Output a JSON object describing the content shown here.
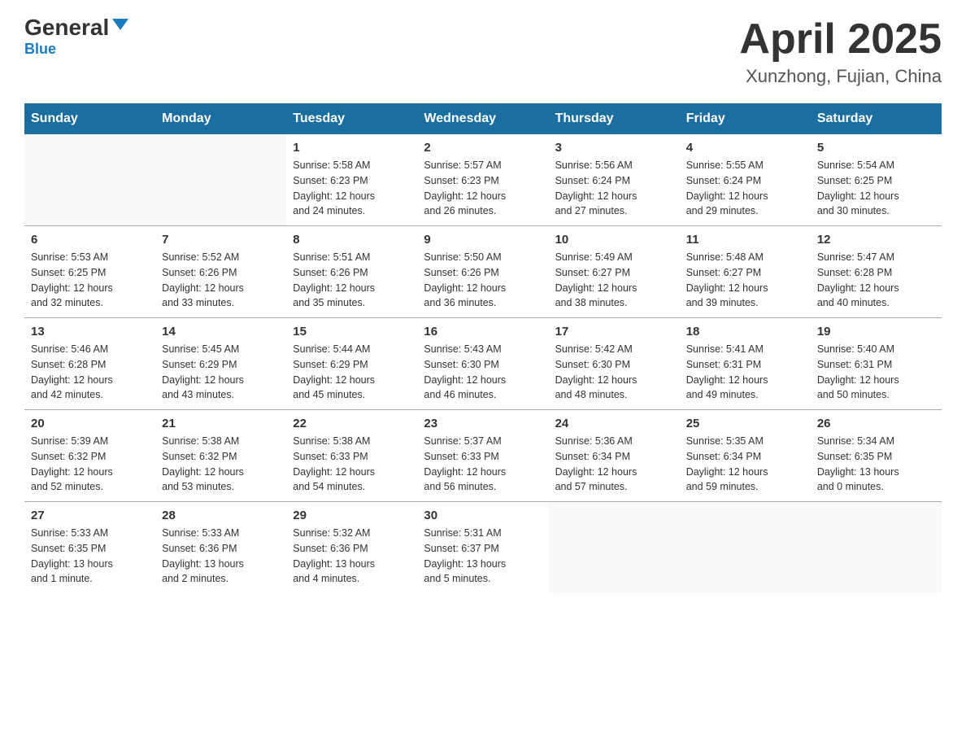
{
  "header": {
    "logo_main": "General",
    "logo_sub": "Blue",
    "title": "April 2025",
    "subtitle": "Xunzhong, Fujian, China"
  },
  "days_of_week": [
    "Sunday",
    "Monday",
    "Tuesday",
    "Wednesday",
    "Thursday",
    "Friday",
    "Saturday"
  ],
  "weeks": [
    [
      {
        "day": "",
        "info": ""
      },
      {
        "day": "",
        "info": ""
      },
      {
        "day": "1",
        "info": "Sunrise: 5:58 AM\nSunset: 6:23 PM\nDaylight: 12 hours\nand 24 minutes."
      },
      {
        "day": "2",
        "info": "Sunrise: 5:57 AM\nSunset: 6:23 PM\nDaylight: 12 hours\nand 26 minutes."
      },
      {
        "day": "3",
        "info": "Sunrise: 5:56 AM\nSunset: 6:24 PM\nDaylight: 12 hours\nand 27 minutes."
      },
      {
        "day": "4",
        "info": "Sunrise: 5:55 AM\nSunset: 6:24 PM\nDaylight: 12 hours\nand 29 minutes."
      },
      {
        "day": "5",
        "info": "Sunrise: 5:54 AM\nSunset: 6:25 PM\nDaylight: 12 hours\nand 30 minutes."
      }
    ],
    [
      {
        "day": "6",
        "info": "Sunrise: 5:53 AM\nSunset: 6:25 PM\nDaylight: 12 hours\nand 32 minutes."
      },
      {
        "day": "7",
        "info": "Sunrise: 5:52 AM\nSunset: 6:26 PM\nDaylight: 12 hours\nand 33 minutes."
      },
      {
        "day": "8",
        "info": "Sunrise: 5:51 AM\nSunset: 6:26 PM\nDaylight: 12 hours\nand 35 minutes."
      },
      {
        "day": "9",
        "info": "Sunrise: 5:50 AM\nSunset: 6:26 PM\nDaylight: 12 hours\nand 36 minutes."
      },
      {
        "day": "10",
        "info": "Sunrise: 5:49 AM\nSunset: 6:27 PM\nDaylight: 12 hours\nand 38 minutes."
      },
      {
        "day": "11",
        "info": "Sunrise: 5:48 AM\nSunset: 6:27 PM\nDaylight: 12 hours\nand 39 minutes."
      },
      {
        "day": "12",
        "info": "Sunrise: 5:47 AM\nSunset: 6:28 PM\nDaylight: 12 hours\nand 40 minutes."
      }
    ],
    [
      {
        "day": "13",
        "info": "Sunrise: 5:46 AM\nSunset: 6:28 PM\nDaylight: 12 hours\nand 42 minutes."
      },
      {
        "day": "14",
        "info": "Sunrise: 5:45 AM\nSunset: 6:29 PM\nDaylight: 12 hours\nand 43 minutes."
      },
      {
        "day": "15",
        "info": "Sunrise: 5:44 AM\nSunset: 6:29 PM\nDaylight: 12 hours\nand 45 minutes."
      },
      {
        "day": "16",
        "info": "Sunrise: 5:43 AM\nSunset: 6:30 PM\nDaylight: 12 hours\nand 46 minutes."
      },
      {
        "day": "17",
        "info": "Sunrise: 5:42 AM\nSunset: 6:30 PM\nDaylight: 12 hours\nand 48 minutes."
      },
      {
        "day": "18",
        "info": "Sunrise: 5:41 AM\nSunset: 6:31 PM\nDaylight: 12 hours\nand 49 minutes."
      },
      {
        "day": "19",
        "info": "Sunrise: 5:40 AM\nSunset: 6:31 PM\nDaylight: 12 hours\nand 50 minutes."
      }
    ],
    [
      {
        "day": "20",
        "info": "Sunrise: 5:39 AM\nSunset: 6:32 PM\nDaylight: 12 hours\nand 52 minutes."
      },
      {
        "day": "21",
        "info": "Sunrise: 5:38 AM\nSunset: 6:32 PM\nDaylight: 12 hours\nand 53 minutes."
      },
      {
        "day": "22",
        "info": "Sunrise: 5:38 AM\nSunset: 6:33 PM\nDaylight: 12 hours\nand 54 minutes."
      },
      {
        "day": "23",
        "info": "Sunrise: 5:37 AM\nSunset: 6:33 PM\nDaylight: 12 hours\nand 56 minutes."
      },
      {
        "day": "24",
        "info": "Sunrise: 5:36 AM\nSunset: 6:34 PM\nDaylight: 12 hours\nand 57 minutes."
      },
      {
        "day": "25",
        "info": "Sunrise: 5:35 AM\nSunset: 6:34 PM\nDaylight: 12 hours\nand 59 minutes."
      },
      {
        "day": "26",
        "info": "Sunrise: 5:34 AM\nSunset: 6:35 PM\nDaylight: 13 hours\nand 0 minutes."
      }
    ],
    [
      {
        "day": "27",
        "info": "Sunrise: 5:33 AM\nSunset: 6:35 PM\nDaylight: 13 hours\nand 1 minute."
      },
      {
        "day": "28",
        "info": "Sunrise: 5:33 AM\nSunset: 6:36 PM\nDaylight: 13 hours\nand 2 minutes."
      },
      {
        "day": "29",
        "info": "Sunrise: 5:32 AM\nSunset: 6:36 PM\nDaylight: 13 hours\nand 4 minutes."
      },
      {
        "day": "30",
        "info": "Sunrise: 5:31 AM\nSunset: 6:37 PM\nDaylight: 13 hours\nand 5 minutes."
      },
      {
        "day": "",
        "info": ""
      },
      {
        "day": "",
        "info": ""
      },
      {
        "day": "",
        "info": ""
      }
    ]
  ]
}
